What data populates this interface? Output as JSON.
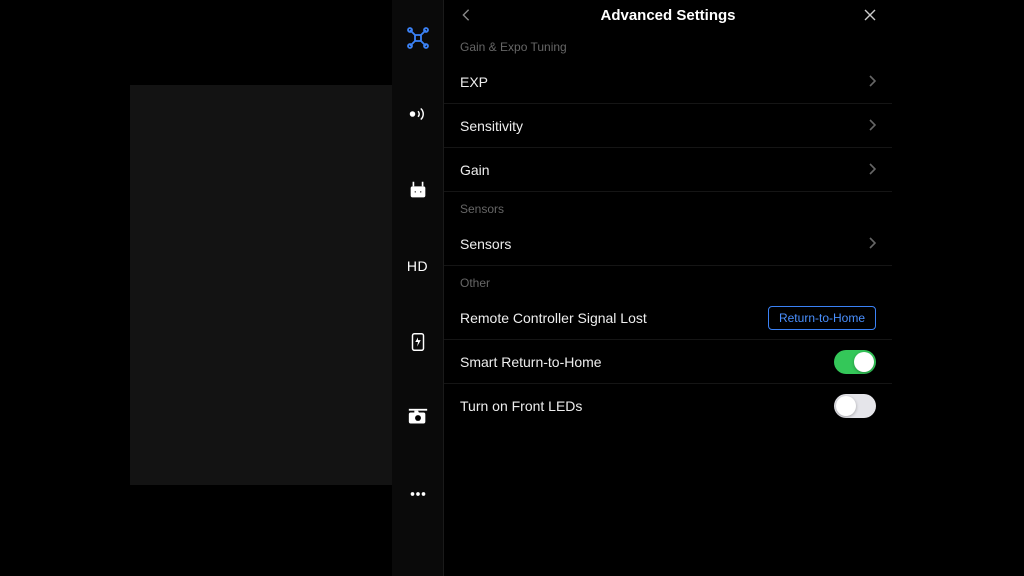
{
  "sidebar": {
    "hd_label": "HD"
  },
  "panel": {
    "title": "Advanced Settings",
    "sections": {
      "gain_expo": {
        "label": "Gain & Expo Tuning",
        "rows": {
          "exp": "EXP",
          "sensitivity": "Sensitivity",
          "gain": "Gain"
        }
      },
      "sensors": {
        "label": "Sensors",
        "rows": {
          "sensors": "Sensors"
        }
      },
      "other": {
        "label": "Other",
        "rows": {
          "signal_lost": "Remote Controller Signal Lost",
          "signal_lost_action": "Return-to-Home",
          "smart_rth": "Smart Return-to-Home",
          "front_leds": "Turn on Front LEDs"
        }
      }
    }
  },
  "toggles": {
    "smart_rth": true,
    "front_leds": false
  },
  "colors": {
    "accent": "#3b82f6",
    "toggle_on": "#34c759",
    "toggle_off": "#e5e5ea"
  }
}
